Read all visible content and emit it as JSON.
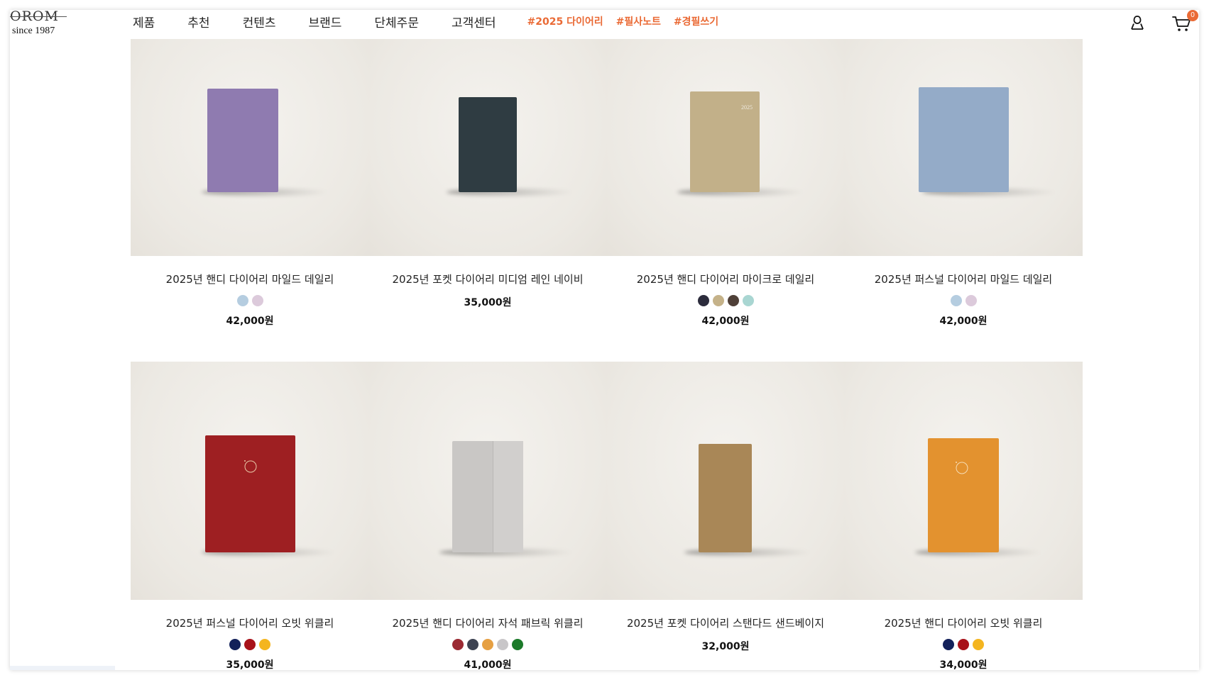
{
  "brand": {
    "logo_text": "OROM",
    "since": "since 1987"
  },
  "nav": {
    "items": [
      "제품",
      "추천",
      "컨텐츠",
      "브랜드",
      "단체주문",
      "고객센터"
    ],
    "tags": [
      "#2025 다이어리",
      "#필사노트",
      "#경필쓰기"
    ]
  },
  "header_icons": {
    "user": "user-icon",
    "cart": "cart-icon",
    "cart_count": "0"
  },
  "accent_color": "#ea6a35",
  "products": [
    {
      "name": "2025년 핸디 다이어리 마일드 데일리",
      "price": "42,000원",
      "swatches": [
        "#b5cde0",
        "#dccadb"
      ],
      "cover_color": "#8f7bb0",
      "cover_text": ""
    },
    {
      "name": "2025년 포켓 다이어리 미디엄 레인 네이비",
      "price": "35,000원",
      "swatches": [],
      "cover_color": "#2f3c42",
      "cover_text": ""
    },
    {
      "name": "2025년 핸디 다이어리 마이크로 데일리",
      "price": "42,000원",
      "swatches": [
        "#2c2c3c",
        "#c5b289",
        "#4f4038",
        "#a9d6d2"
      ],
      "cover_color": "#c2b089",
      "cover_text": "2025"
    },
    {
      "name": "2025년 퍼스널 다이어리 마일드 데일리",
      "price": "42,000원",
      "swatches": [
        "#b5cde0",
        "#dccadb"
      ],
      "cover_color": "#94abc8",
      "cover_text": ""
    },
    {
      "name": "2025년 퍼스널 다이어리 오빗 위클리",
      "price": "35,000원",
      "swatches": [
        "#13215a",
        "#a8121a",
        "#f4b51f"
      ],
      "cover_color": "#9e1f22",
      "cover_text": ""
    },
    {
      "name": "2025년 핸디 다이어리 자석 패브릭 위클리",
      "price": "41,000원",
      "swatches": [
        "#9b2a33",
        "#3d4352",
        "#e6a043",
        "#c8c6c8",
        "#1c7a2a"
      ],
      "cover_color": "#c9c7c5",
      "cover_text": ""
    },
    {
      "name": "2025년 포켓 다이어리 스탠다드 샌드베이지",
      "price": "32,000원",
      "swatches": [],
      "cover_color": "#a98757",
      "cover_text": ""
    },
    {
      "name": "2025년 핸디 다이어리 오빗 위클리",
      "price": "34,000원",
      "swatches": [
        "#13215a",
        "#a8121a",
        "#f4b51f"
      ],
      "cover_color": "#e3922f",
      "cover_text": ""
    }
  ]
}
